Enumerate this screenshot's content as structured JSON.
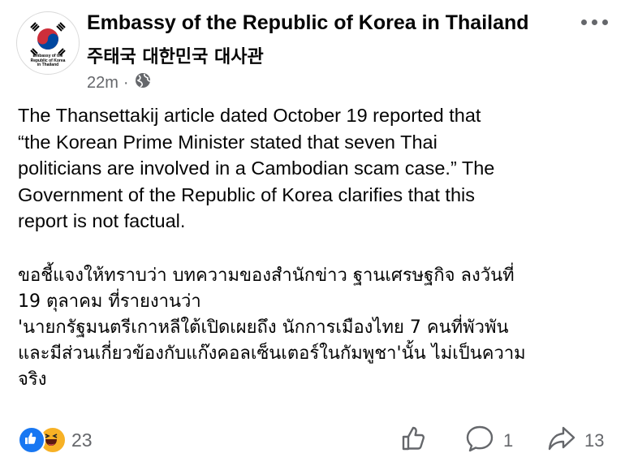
{
  "page": {
    "name": "Embassy of the Republic of Korea in Thailand",
    "name_korean": "주태국 대한민국 대사관",
    "avatar_text_lines": [
      "Embassy of the",
      "Republic of Korea",
      "in Thailand"
    ]
  },
  "post": {
    "time": "22m",
    "separator": "·",
    "audience_icon": "globe-icon",
    "english_lines": [
      "The Thansettakij article dated October 19 reported that",
      "“the Korean Prime Minister stated that seven Thai",
      "politicians are involved in a Cambodian scam case.”  The",
      "Government of the Republic of Korea clarifies that this",
      "report is not factual."
    ],
    "thai_lines": [
      "ขอชี้แจงให้ทราบว่า บทความของสำนักข่าว ฐานเศรษฐกิจ ลงวันที่",
      "19 ตุลาคม ที่รายงานว่า",
      "'นายกรัฐมนตรีเกาหลีใต้เปิดเผยถึง นักการเมืองไทย 7 คนที่พัวพัน",
      "และมีส่วนเกี่ยวข้องกับแก๊งคอลเซ็นเตอร์ในกัมพูชา'นั้น ไม่เป็นความ",
      "จริง"
    ]
  },
  "footer": {
    "reaction_icons": [
      "like-reaction-icon",
      "haha-reaction-icon"
    ],
    "reaction_count": "23",
    "comment_count": "1",
    "share_count": "13"
  },
  "colors": {
    "text": "#050505",
    "secondary": "#65676b",
    "like_blue": "#1877f2",
    "haha_yellow": "#f7b125"
  }
}
